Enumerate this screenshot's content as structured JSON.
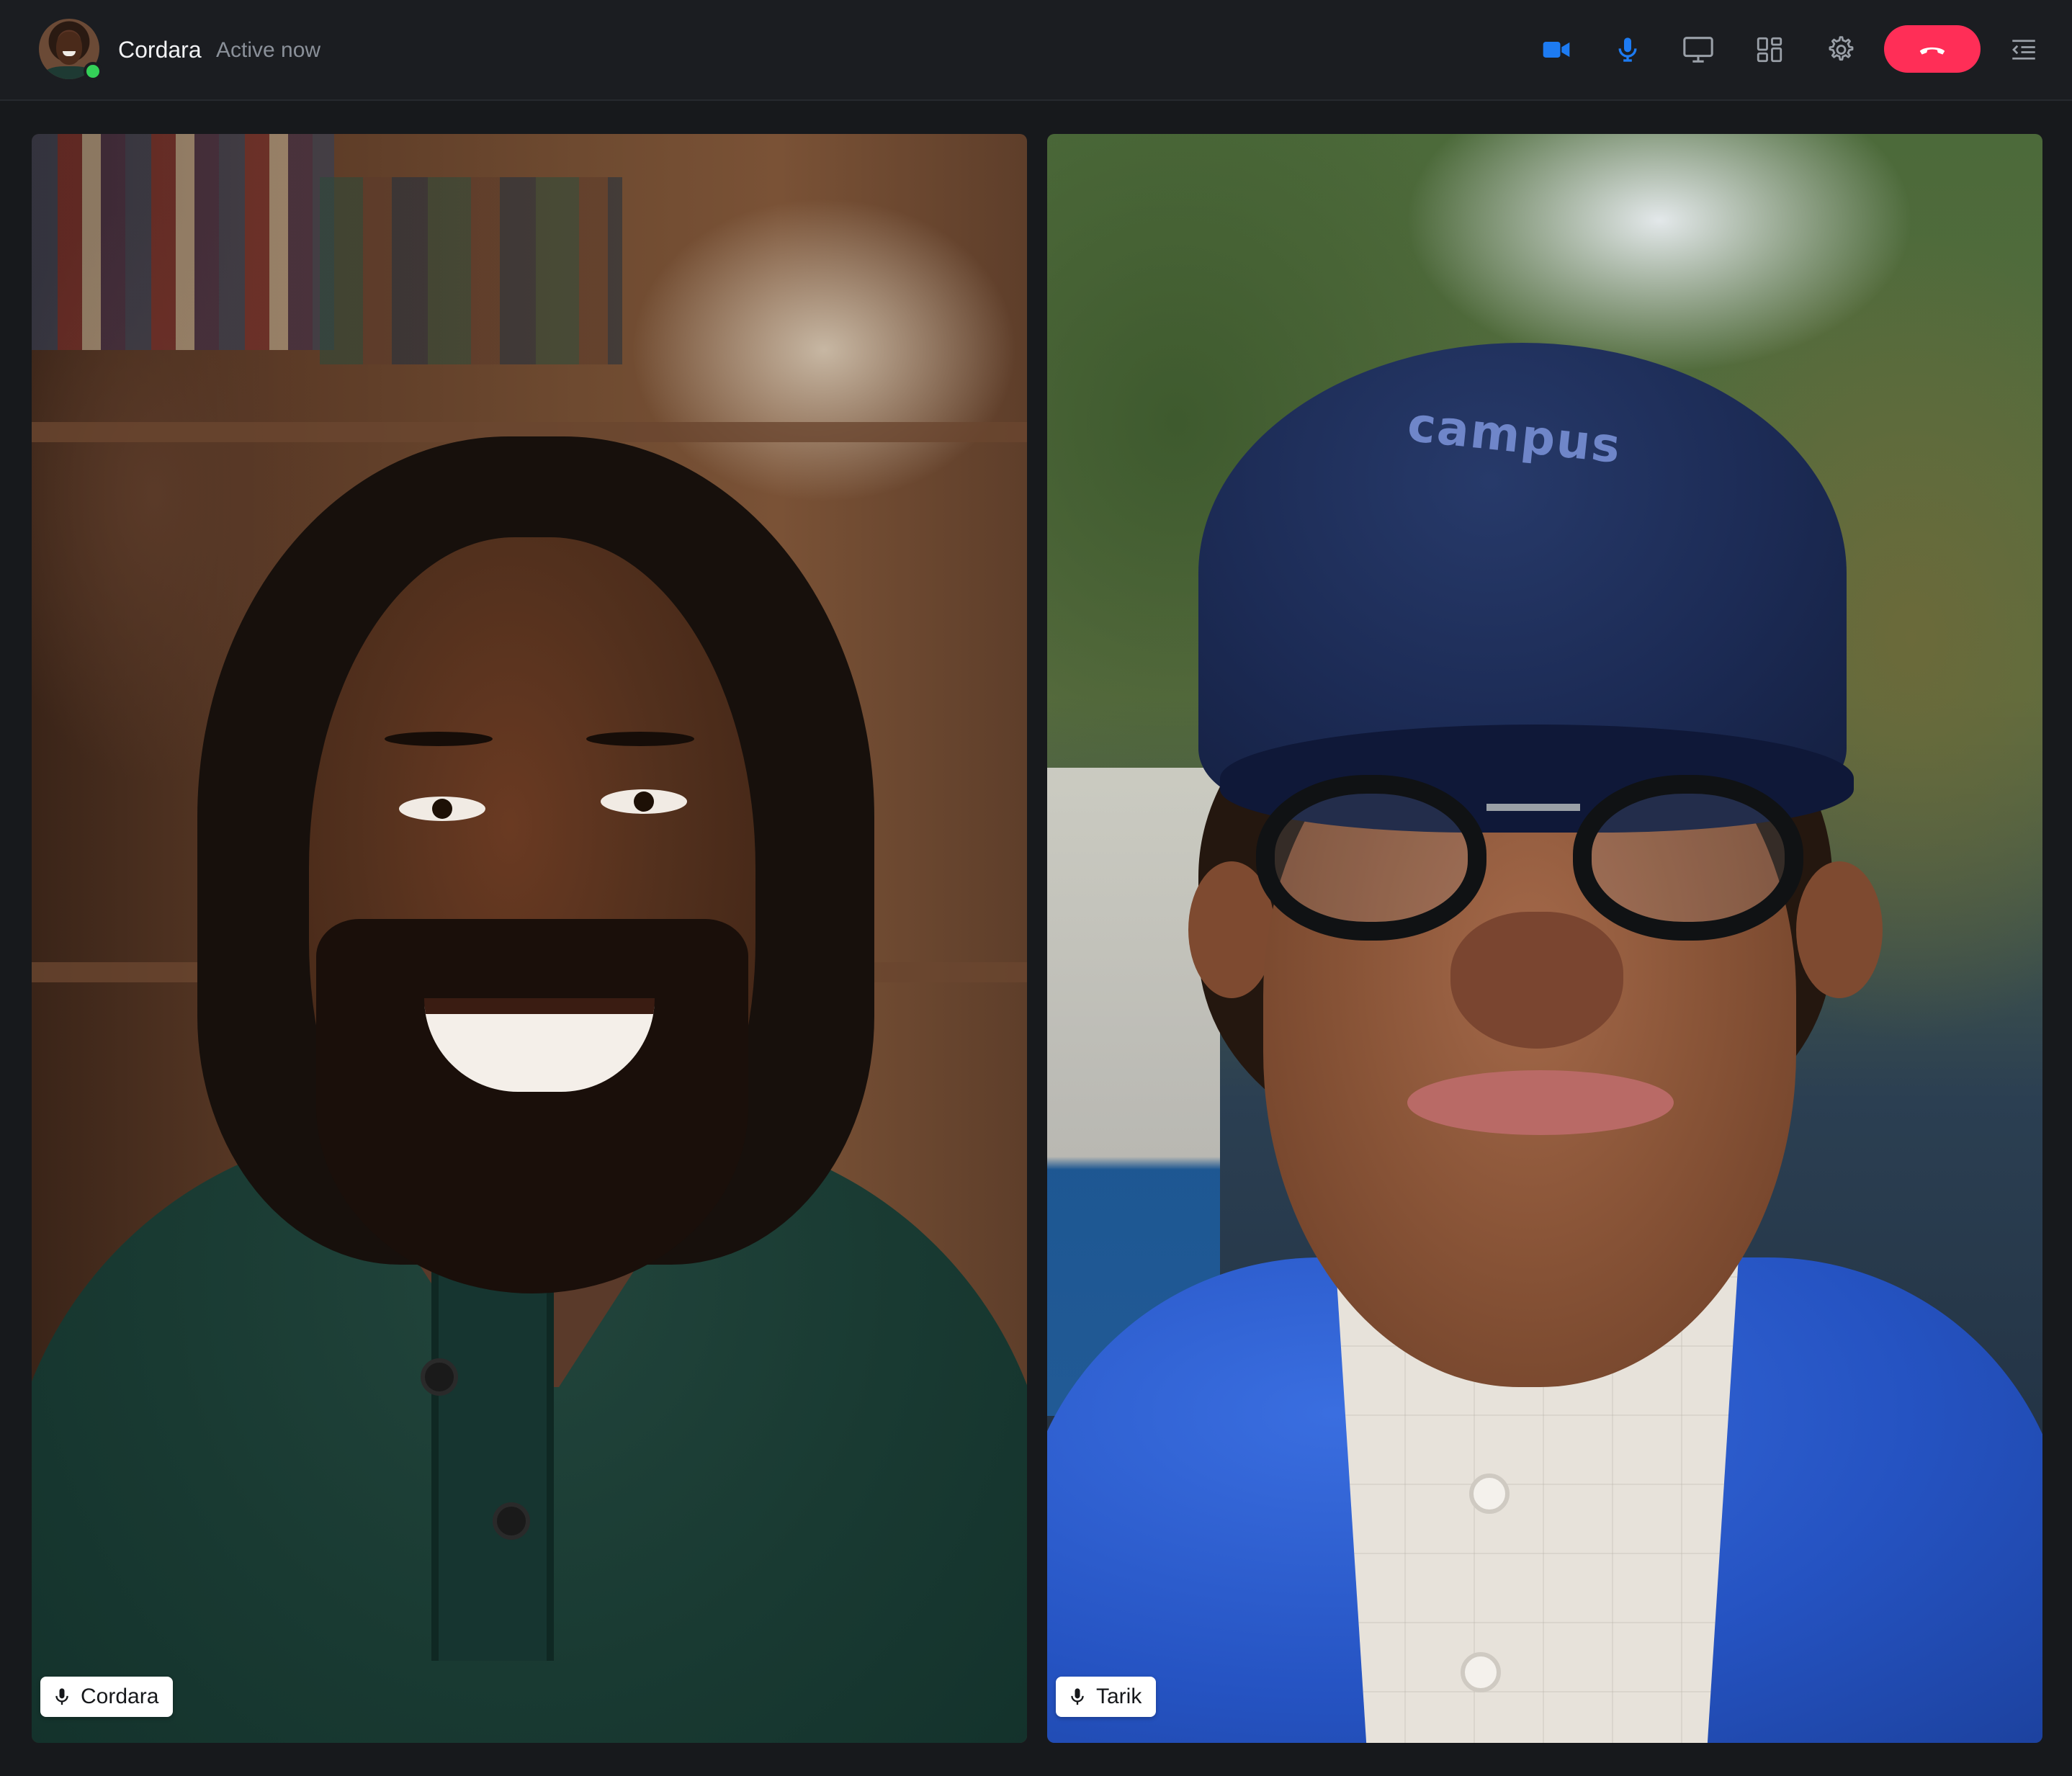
{
  "header": {
    "caller_name": "Cordara",
    "caller_status": "Active now",
    "online_color": "#34d058"
  },
  "controls": {
    "camera_icon": "video-camera-icon",
    "mic_icon": "microphone-icon",
    "screen_share_icon": "monitor-icon",
    "layout_icon": "grid-layout-icon",
    "settings_icon": "gear-icon",
    "end_call_icon": "phone-hangup-icon",
    "panel_icon": "collapse-panel-icon",
    "accent_color": "#1d7bf2",
    "end_call_color": "#ff2e57"
  },
  "participants": [
    {
      "name": "Cordara",
      "mic_icon": "microphone-icon"
    },
    {
      "name": "Tarik",
      "mic_icon": "microphone-icon",
      "cap_text": "campus"
    }
  ]
}
